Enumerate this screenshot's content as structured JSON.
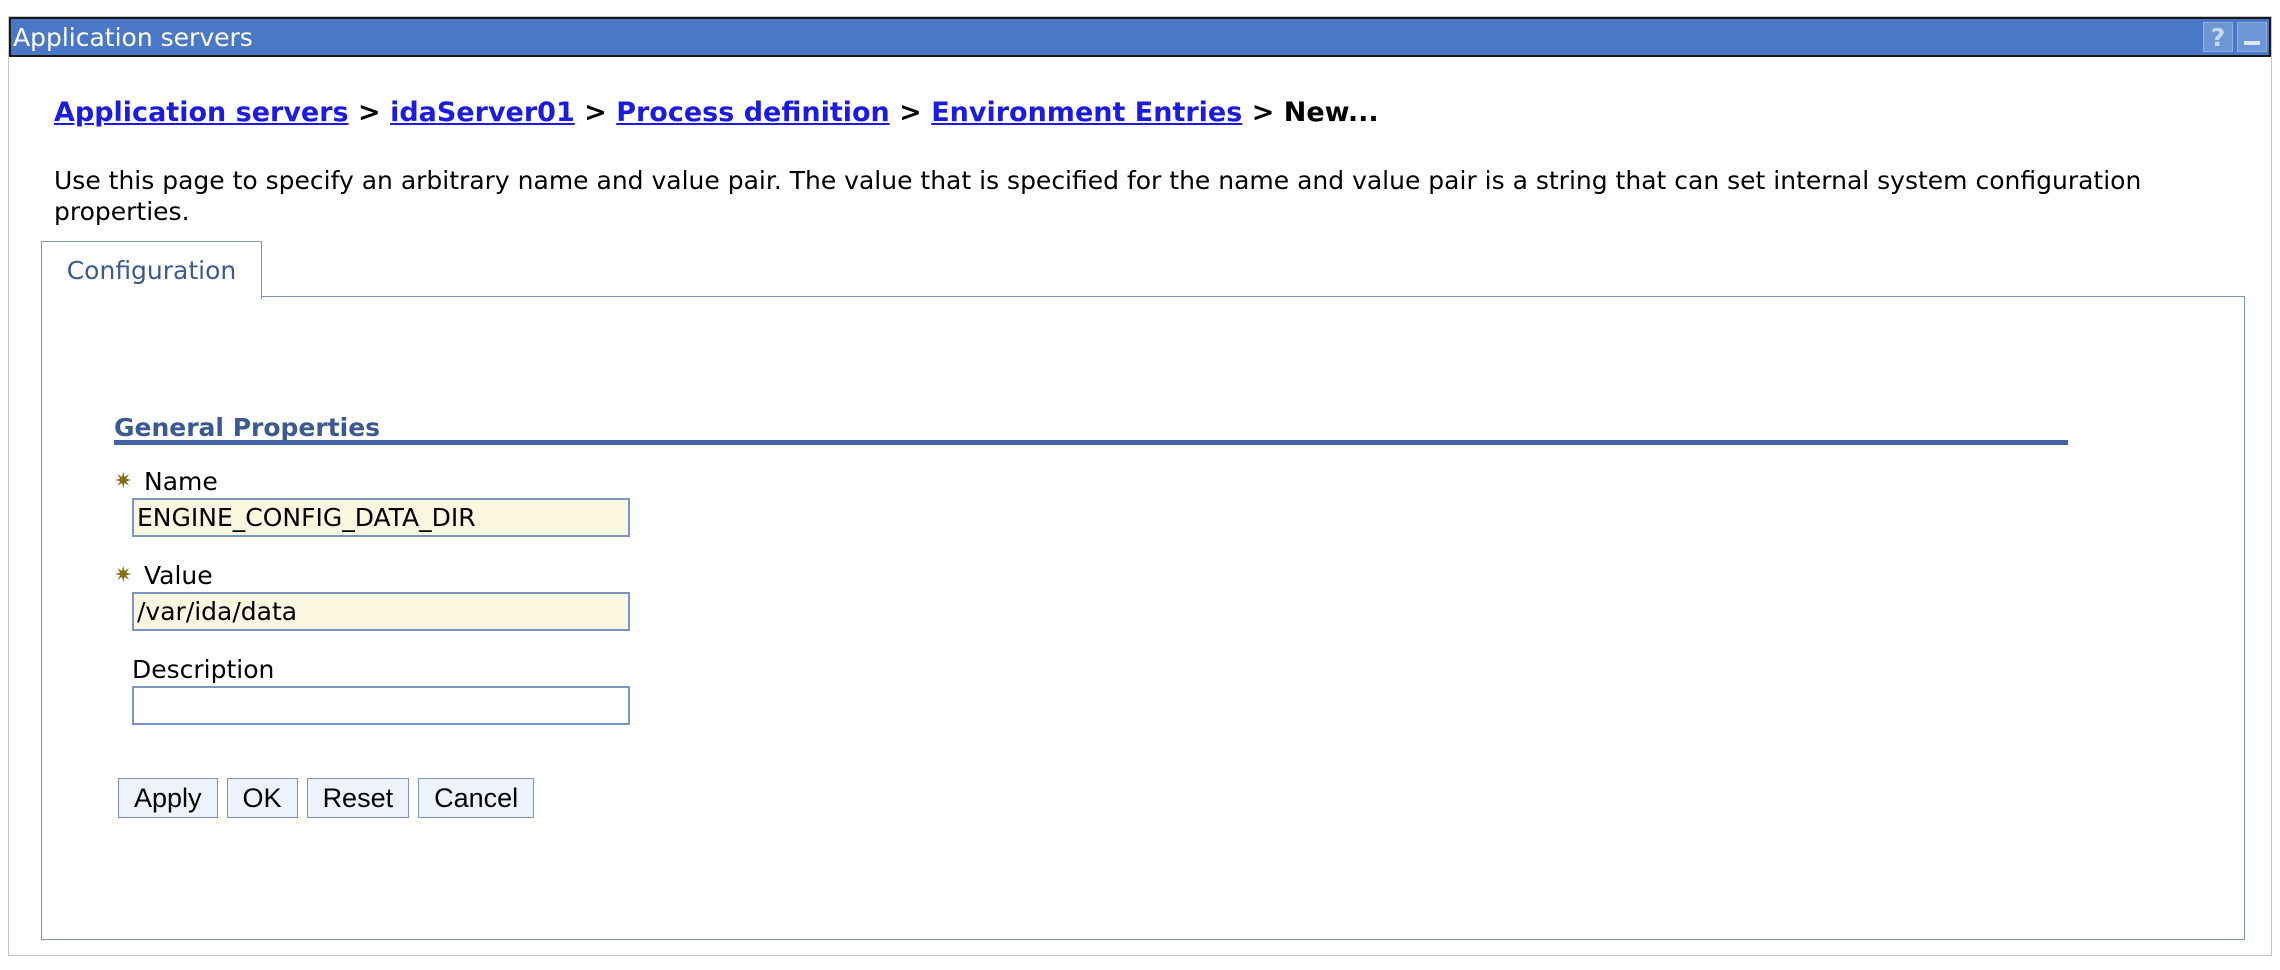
{
  "window": {
    "title": "Application servers",
    "help_glyph": "?",
    "icons": [
      "help-icon",
      "minimize-icon"
    ]
  },
  "breadcrumb": {
    "links": [
      "Application servers",
      "idaServer01",
      "Process definition",
      "Environment Entries"
    ],
    "separator": ">",
    "current": "New..."
  },
  "description": "Use this page to specify an arbitrary name and value pair. The value that is specified for the name and value pair is a string that can set internal system configuration properties.",
  "tabs": [
    {
      "label": "Configuration",
      "active": true
    }
  ],
  "general_properties": {
    "title": "General Properties",
    "required_marker": "✷",
    "fields": [
      {
        "label": "Name",
        "value": "ENGINE_CONFIG_DATA_DIR",
        "required": true
      },
      {
        "label": "Value",
        "value": "/var/ida/data",
        "required": true
      },
      {
        "label": "Description",
        "value": "",
        "required": false
      }
    ]
  },
  "buttons": {
    "apply": "Apply",
    "ok": "OK",
    "reset": "Reset",
    "cancel": "Cancel"
  },
  "colors": {
    "titlebar": "#4a78c7",
    "link": "#1c1ce0",
    "section_title": "#3b5a91",
    "required_input_bg": "#fbf6df"
  }
}
